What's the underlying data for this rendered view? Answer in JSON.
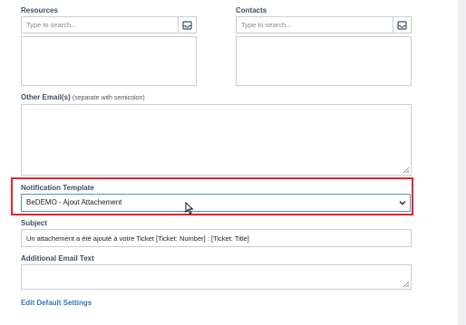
{
  "resources": {
    "label": "Resources",
    "placeholder": "Type to search..."
  },
  "contacts": {
    "label": "Contacts",
    "placeholder": "Type to search..."
  },
  "other_emails": {
    "label": "Other Email(s)",
    "hint": "(separate with semicolon)"
  },
  "notification_template": {
    "label": "Notification Template",
    "selected": "BeDEMO - Ajout Attachement"
  },
  "subject": {
    "label": "Subject",
    "value": "Un attachement a été ajouté à votre Ticket [Ticket: Number] : [Ticket: Title]"
  },
  "additional_email_text": {
    "label": "Additional Email Text"
  },
  "edit_default_settings": "Edit Default Settings",
  "colors": {
    "highlight": "#e4242a",
    "link": "#2a78c2",
    "label": "#3b4e66",
    "focus_border": "#4b93c9"
  }
}
